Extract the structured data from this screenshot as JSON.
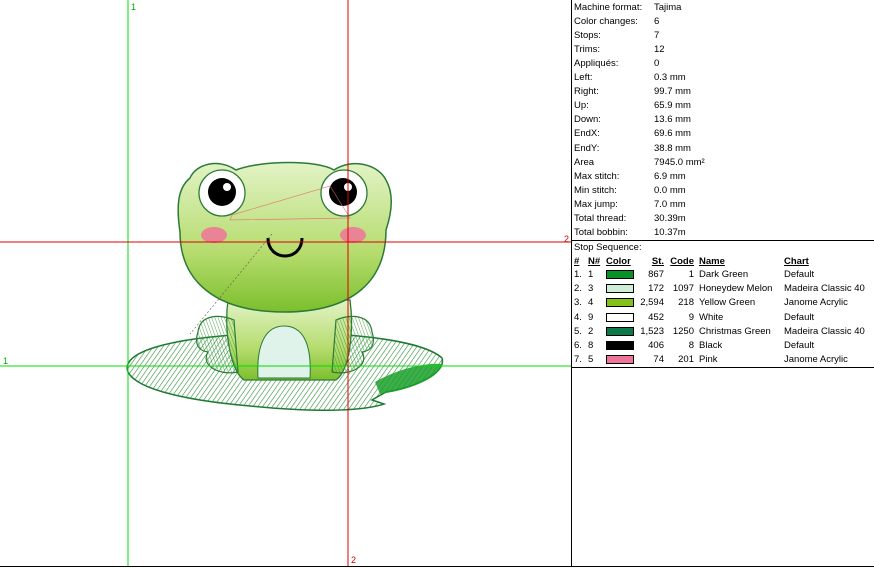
{
  "preview": {
    "axis_labels": [
      "1",
      "2",
      "1",
      "2"
    ],
    "colors": {
      "vertical_1": "#00dd00",
      "horizontal_1": "#00dd00",
      "vertical_2": "#dd0000",
      "horizontal_2": "#dd0000",
      "dark_green": "#089124",
      "honeydew": "#cfeed8",
      "yellow_green": "#82c218",
      "white": "#ffffff",
      "christmas_green": "#0b7a4a",
      "black": "#000000",
      "pink": "#f0739a"
    }
  },
  "stats": [
    {
      "label": "Machine format:",
      "value": "Tajima"
    },
    {
      "label": "Color changes:",
      "value": "6"
    },
    {
      "label": "Stops:",
      "value": "7"
    },
    {
      "label": "Trims:",
      "value": "12"
    },
    {
      "label": "Appliqués:",
      "value": "0"
    },
    {
      "label": "Left:",
      "value": "0.3 mm"
    },
    {
      "label": "Right:",
      "value": "99.7 mm"
    },
    {
      "label": "Up:",
      "value": "65.9 mm"
    },
    {
      "label": "Down:",
      "value": "13.6 mm"
    },
    {
      "label": "EndX:",
      "value": "69.6 mm"
    },
    {
      "label": "EndY:",
      "value": "38.8 mm"
    },
    {
      "label": "Area",
      "value": "7945.0 mm²"
    },
    {
      "label": "Max stitch:",
      "value": "6.9 mm"
    },
    {
      "label": "Min stitch:",
      "value": "0.0 mm"
    },
    {
      "label": "Max jump:",
      "value": "7.0 mm"
    },
    {
      "label": "Total thread:",
      "value": "30.39m"
    },
    {
      "label": "Total bobbin:",
      "value": "10.37m"
    }
  ],
  "sequence": {
    "title": "Stop Sequence:",
    "headers": {
      "num": "#",
      "n": "N#",
      "color": "Color",
      "st": "St.",
      "code": "Code",
      "name": "Name",
      "chart": "Chart"
    },
    "rows": [
      {
        "num": "1.",
        "n": "1",
        "swatch": "#089124",
        "st": "867",
        "code": "1",
        "name": "Dark Green",
        "chart": "Default"
      },
      {
        "num": "2.",
        "n": "3",
        "swatch": "#cfeed8",
        "st": "172",
        "code": "1097",
        "name": "Honeydew Melon",
        "chart": "Madeira Classic 40"
      },
      {
        "num": "3.",
        "n": "4",
        "swatch": "#82c218",
        "st": "2,594",
        "code": "218",
        "name": "Yellow Green",
        "chart": "Janome Acrylic"
      },
      {
        "num": "4.",
        "n": "9",
        "swatch": "#ffffff",
        "st": "452",
        "code": "9",
        "name": "White",
        "chart": "Default"
      },
      {
        "num": "5.",
        "n": "2",
        "swatch": "#0b7a4a",
        "st": "1,523",
        "code": "1250",
        "name": "Christmas Green",
        "chart": "Madeira Classic 40"
      },
      {
        "num": "6.",
        "n": "8",
        "swatch": "#000000",
        "st": "406",
        "code": "8",
        "name": "Black",
        "chart": "Default"
      },
      {
        "num": "7.",
        "n": "5",
        "swatch": "#f0739a",
        "st": "74",
        "code": "201",
        "name": "Pink",
        "chart": "Janome Acrylic"
      }
    ]
  }
}
